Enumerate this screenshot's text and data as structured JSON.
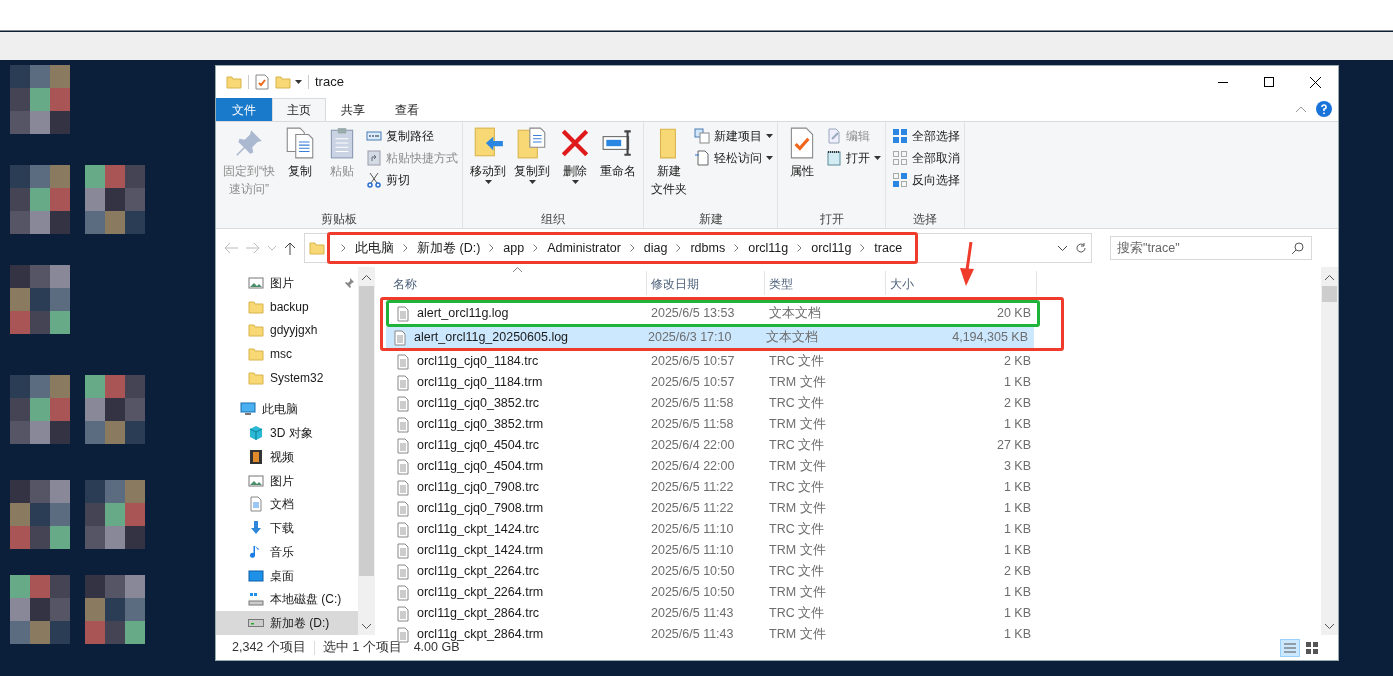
{
  "window": {
    "title": "trace"
  },
  "ribbon_tabs": [
    {
      "label": "文件",
      "kind": "file",
      "selected": false
    },
    {
      "label": "主页",
      "kind": "tab",
      "selected": true
    },
    {
      "label": "共享",
      "kind": "tab",
      "selected": false
    },
    {
      "label": "查看",
      "kind": "tab",
      "selected": false
    }
  ],
  "ribbon_groups": [
    {
      "label": "剪贴板",
      "large": [
        {
          "lines": [
            "固定到“快",
            "速访问”"
          ],
          "disabled": true,
          "dropdown": false
        },
        {
          "lines": [
            "复制"
          ],
          "disabled": false,
          "dropdown": false
        },
        {
          "lines": [
            "粘贴"
          ],
          "disabled": true,
          "dropdown": false
        }
      ],
      "small": [
        {
          "label": "复制路径",
          "disabled": false,
          "dropdown": false
        },
        {
          "label": "粘贴快捷方式",
          "disabled": true,
          "dropdown": false
        },
        {
          "label": "剪切",
          "disabled": false,
          "dropdown": false
        }
      ]
    },
    {
      "label": "组织",
      "large": [
        {
          "lines": [
            "移动到"
          ],
          "disabled": false,
          "dropdown": true
        },
        {
          "lines": [
            "复制到"
          ],
          "disabled": false,
          "dropdown": true
        },
        {
          "lines": [
            "删除"
          ],
          "disabled": false,
          "dropdown": true
        },
        {
          "lines": [
            "重命名"
          ],
          "disabled": false,
          "dropdown": false
        }
      ]
    },
    {
      "label": "新建",
      "large": [
        {
          "lines": [
            "新建",
            "文件夹"
          ],
          "disabled": false,
          "dropdown": false
        }
      ],
      "small": [
        {
          "label": "新建项目",
          "disabled": false,
          "dropdown": true
        },
        {
          "label": "轻松访问",
          "disabled": false,
          "dropdown": true
        }
      ]
    },
    {
      "label": "打开",
      "large": [
        {
          "lines": [
            "属性"
          ],
          "disabled": false,
          "dropdown": false
        }
      ],
      "small": [
        {
          "label": "编辑",
          "disabled": true,
          "dropdown": false
        },
        {
          "label": "打开",
          "disabled": false,
          "dropdown": true
        }
      ]
    },
    {
      "label": "选择",
      "small": [
        {
          "label": "全部选择",
          "disabled": false,
          "dropdown": false
        },
        {
          "label": "全部取消",
          "disabled": false,
          "dropdown": false
        },
        {
          "label": "反向选择",
          "disabled": false,
          "dropdown": false
        }
      ]
    }
  ],
  "address": {
    "path": [
      "此电脑",
      "新加卷 (D:)",
      "app",
      "Administrator",
      "diag",
      "rdbms",
      "orcl11g",
      "orcl11g",
      "trace"
    ]
  },
  "search": {
    "placeholder": "搜索\"trace\""
  },
  "nav": {
    "quick_items": [
      {
        "label": "图片",
        "pinned": true
      },
      {
        "label": "backup",
        "pinned": false
      },
      {
        "label": "gdyyjgxh",
        "pinned": false
      },
      {
        "label": "msc",
        "pinned": false
      },
      {
        "label": "System32",
        "pinned": false
      }
    ],
    "this_pc": {
      "label": "此电脑",
      "children": [
        {
          "label": "3D 对象",
          "selected": false
        },
        {
          "label": "视频",
          "selected": false
        },
        {
          "label": "图片",
          "selected": false
        },
        {
          "label": "文档",
          "selected": false
        },
        {
          "label": "下载",
          "selected": false
        },
        {
          "label": "音乐",
          "selected": false
        },
        {
          "label": "桌面",
          "selected": false
        },
        {
          "label": "本地磁盘 (C:)",
          "selected": false
        },
        {
          "label": "新加卷 (D:)",
          "selected": true
        }
      ]
    }
  },
  "table": {
    "columns": [
      "名称",
      "修改日期",
      "类型",
      "大小"
    ],
    "rows": [
      {
        "name": "alert_orcl11g.log",
        "date": "2025/6/5 13:53",
        "type": "文本文档",
        "size": "20 KB",
        "selected": false
      },
      {
        "name": "alert_orcl11g_20250605.log",
        "date": "2025/6/3 17:10",
        "type": "文本文档",
        "size": "4,194,305 KB",
        "selected": true
      },
      {
        "name": "orcl11g_cjq0_1184.trc",
        "date": "2025/6/5 10:57",
        "type": "TRC 文件",
        "size": "2 KB",
        "selected": false
      },
      {
        "name": "orcl11g_cjq0_1184.trm",
        "date": "2025/6/5 10:57",
        "type": "TRM 文件",
        "size": "1 KB",
        "selected": false
      },
      {
        "name": "orcl11g_cjq0_3852.trc",
        "date": "2025/6/5 11:58",
        "type": "TRC 文件",
        "size": "2 KB",
        "selected": false
      },
      {
        "name": "orcl11g_cjq0_3852.trm",
        "date": "2025/6/5 11:58",
        "type": "TRM 文件",
        "size": "1 KB",
        "selected": false
      },
      {
        "name": "orcl11g_cjq0_4504.trc",
        "date": "2025/6/4 22:00",
        "type": "TRC 文件",
        "size": "27 KB",
        "selected": false
      },
      {
        "name": "orcl11g_cjq0_4504.trm",
        "date": "2025/6/4 22:00",
        "type": "TRM 文件",
        "size": "3 KB",
        "selected": false
      },
      {
        "name": "orcl11g_cjq0_7908.trc",
        "date": "2025/6/5 11:22",
        "type": "TRC 文件",
        "size": "1 KB",
        "selected": false
      },
      {
        "name": "orcl11g_cjq0_7908.trm",
        "date": "2025/6/5 11:22",
        "type": "TRM 文件",
        "size": "1 KB",
        "selected": false
      },
      {
        "name": "orcl11g_ckpt_1424.trc",
        "date": "2025/6/5 11:10",
        "type": "TRC 文件",
        "size": "1 KB",
        "selected": false
      },
      {
        "name": "orcl11g_ckpt_1424.trm",
        "date": "2025/6/5 11:10",
        "type": "TRM 文件",
        "size": "1 KB",
        "selected": false
      },
      {
        "name": "orcl11g_ckpt_2264.trc",
        "date": "2025/6/5 10:50",
        "type": "TRC 文件",
        "size": "2 KB",
        "selected": false
      },
      {
        "name": "orcl11g_ckpt_2264.trm",
        "date": "2025/6/5 10:50",
        "type": "TRM 文件",
        "size": "1 KB",
        "selected": false
      },
      {
        "name": "orcl11g_ckpt_2864.trc",
        "date": "2025/6/5 11:43",
        "type": "TRC 文件",
        "size": "1 KB",
        "selected": false
      },
      {
        "name": "orcl11g_ckpt_2864.trm",
        "date": "2025/6/5 11:43",
        "type": "TRM 文件",
        "size": "1 KB",
        "selected": false
      }
    ]
  },
  "status_bar": {
    "item_count": "2,342 个项目",
    "selection": "选中 1 个项目",
    "selection_size": "4.00 GB"
  }
}
